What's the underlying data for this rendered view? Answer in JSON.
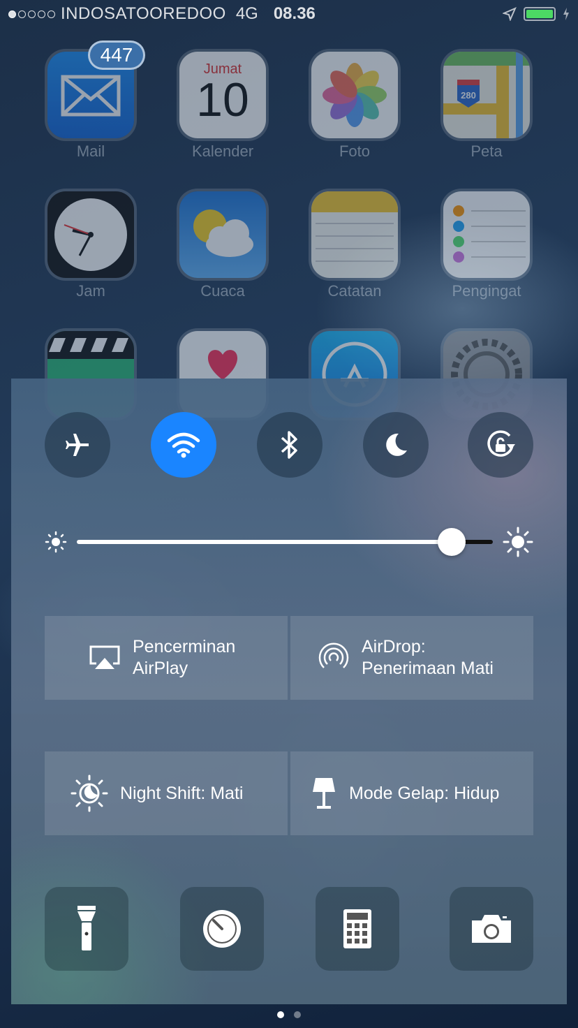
{
  "status_bar": {
    "carrier": "INDOSATOOREDOO",
    "network": "4G",
    "time": "08.36",
    "battery_color": "#4cd964"
  },
  "home": {
    "apps": [
      {
        "label": "Mail",
        "icon": "mail-icon",
        "badge": "447"
      },
      {
        "label": "Kalender",
        "icon": "calendar-icon",
        "day_name": "Jumat",
        "day": "10"
      },
      {
        "label": "Foto",
        "icon": "photos-icon"
      },
      {
        "label": "Peta",
        "icon": "maps-icon",
        "route": "280"
      },
      {
        "label": "Jam",
        "icon": "clock-icon"
      },
      {
        "label": "Cuaca",
        "icon": "weather-icon"
      },
      {
        "label": "Catatan",
        "icon": "notes-icon"
      },
      {
        "label": "Pengingat",
        "icon": "reminders-icon"
      },
      {
        "label": "",
        "icon": "videos-icon"
      },
      {
        "label": "",
        "icon": "health-icon"
      },
      {
        "label": "",
        "icon": "app-store-icon"
      },
      {
        "label": "",
        "icon": "settings-icon"
      }
    ]
  },
  "control_center": {
    "toggles": [
      {
        "name": "airplane-mode",
        "icon": "airplane-icon",
        "active": false
      },
      {
        "name": "wifi",
        "icon": "wifi-icon",
        "active": true
      },
      {
        "name": "bluetooth",
        "icon": "bluetooth-icon",
        "active": false
      },
      {
        "name": "do-not-disturb",
        "icon": "moon-icon",
        "active": false
      },
      {
        "name": "rotation-lock",
        "icon": "rotation-lock-icon",
        "active": false
      }
    ],
    "brightness": 0.9,
    "airplay": {
      "line1": "Pencerminan",
      "line2": "AirPlay"
    },
    "airdrop": {
      "line1": "AirDrop:",
      "line2": "Penerimaan Mati"
    },
    "night_shift": "Night Shift: Mati",
    "dark_mode": "Mode Gelap: Hidup",
    "shortcuts": [
      {
        "name": "flashlight",
        "icon": "flashlight-icon"
      },
      {
        "name": "timer",
        "icon": "timer-icon"
      },
      {
        "name": "calculator",
        "icon": "calculator-icon"
      },
      {
        "name": "camera",
        "icon": "camera-icon"
      }
    ],
    "page_count": 2,
    "current_page": 1,
    "active_color": "#1a85ff"
  }
}
